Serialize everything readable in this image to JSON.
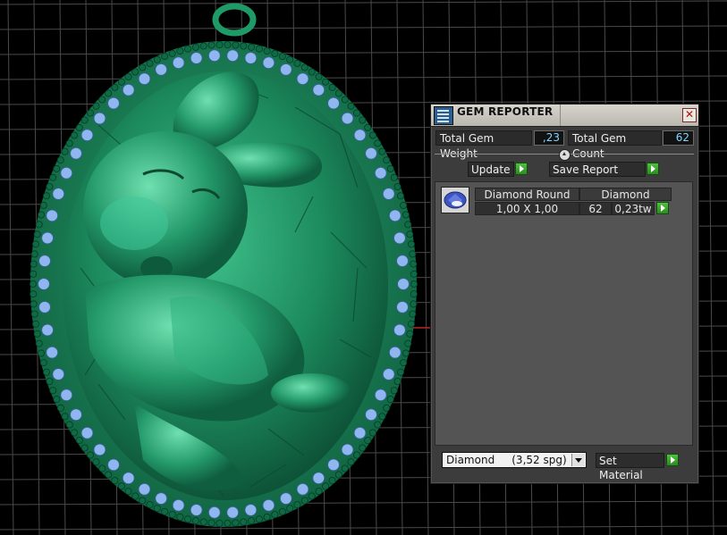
{
  "gem_reporter": {
    "title": "GEM REPORTER",
    "close_symbol": "✕",
    "total_gem_weight_label": "Total Gem Weight",
    "total_gem_weight_value": ",23",
    "total_gem_count_label": "Total Gem Count",
    "total_gem_count_value": "62",
    "update_label": "Update",
    "save_report_label": "Save Report",
    "gems": [
      {
        "name": "Diamond Round",
        "material": "Diamond",
        "size": "1,00 X 1,00",
        "count": "62",
        "weight": "0,23tw"
      }
    ],
    "material_select_value": "Diamond     (3,52 spg)",
    "set_material_label": "Set Material"
  },
  "icons": {
    "title": "report-icon",
    "close": "close-icon",
    "update": "play-arrow-icon",
    "save_report": "play-arrow-icon",
    "row_action": "play-arrow-icon",
    "set_material": "play-arrow-icon",
    "gem_thumb": "round-gem-icon",
    "select": "chevron-down-icon"
  },
  "colors": {
    "viewport_background": "#000000",
    "grid_line": "#4a4a4a",
    "model_green": "#1f8a5e",
    "gem_blue": "#8fb6ef",
    "value_text": "#7fd6ff",
    "accent_green": "#3fae2e"
  }
}
